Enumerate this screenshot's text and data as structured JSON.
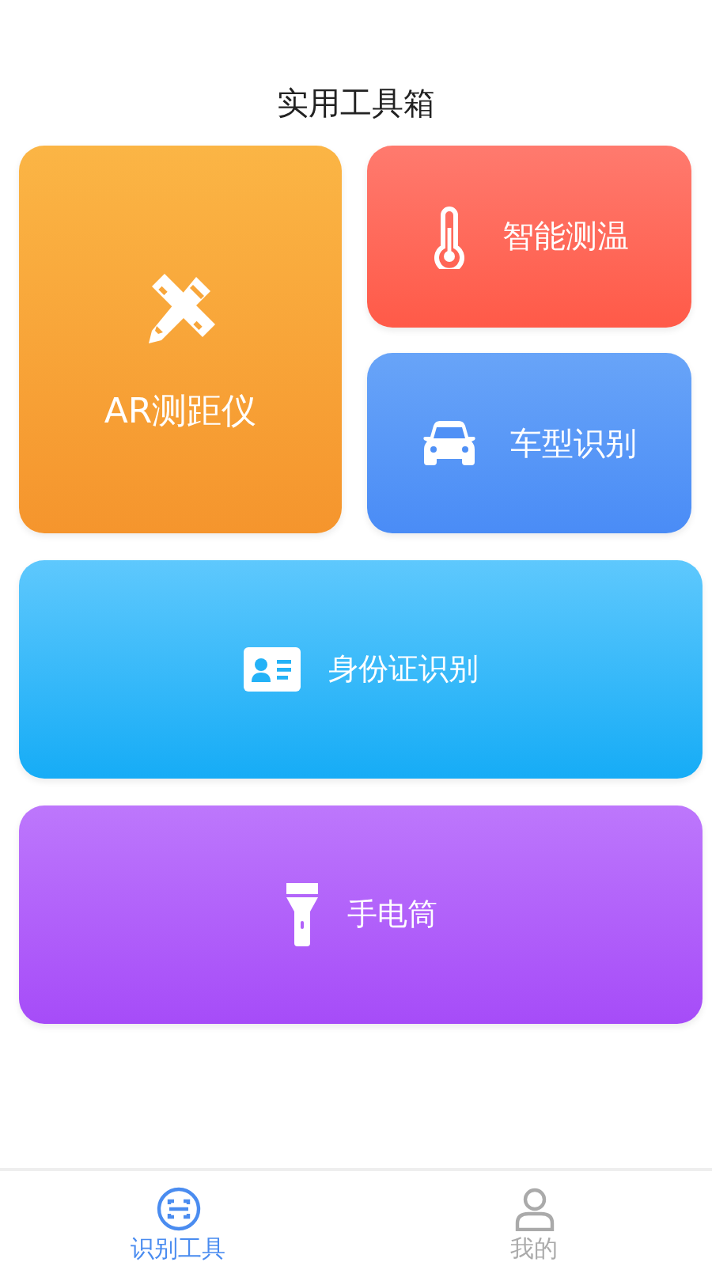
{
  "header": {
    "title": "实用工具箱"
  },
  "tools": [
    {
      "kind": "ruler",
      "label": "AR测距仪"
    },
    {
      "kind": "thermometer",
      "label": "智能测温"
    },
    {
      "kind": "car",
      "label": "车型识别"
    },
    {
      "kind": "idcard",
      "label": "身份证识别"
    },
    {
      "kind": "flashlight",
      "label": "手电筒"
    }
  ],
  "tab_bar": [
    {
      "kind": "scan",
      "label": "识别工具",
      "selected": true
    },
    {
      "kind": "person",
      "label": "我的",
      "selected": false
    }
  ]
}
